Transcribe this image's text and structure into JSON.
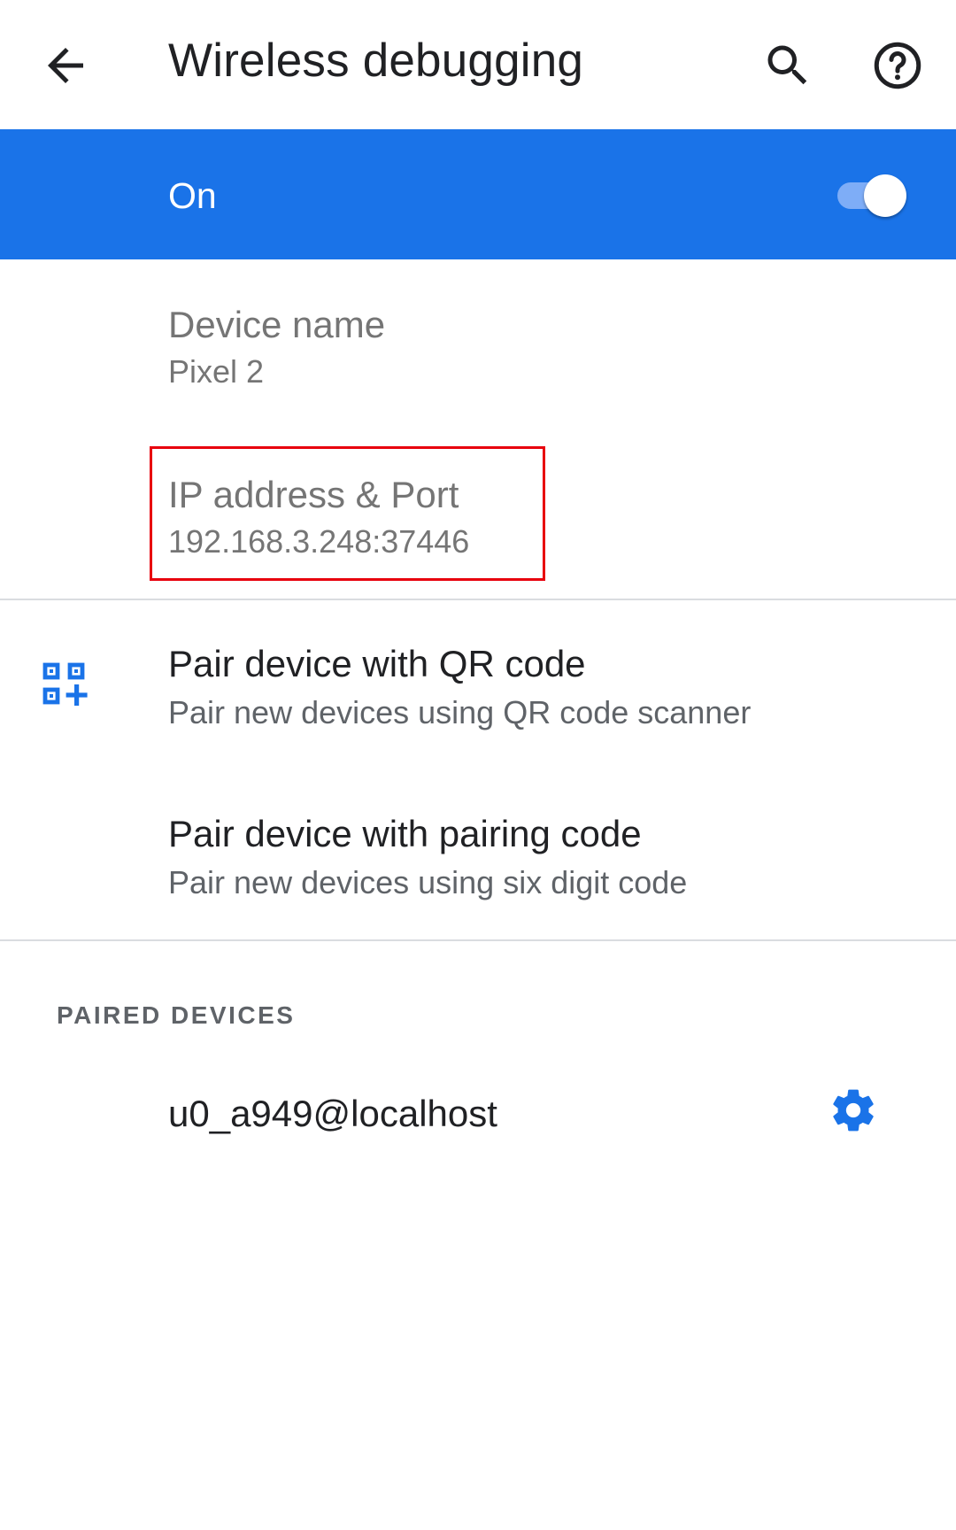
{
  "appbar": {
    "title": "Wireless debugging",
    "back_icon": "arrow-back-icon",
    "search_icon": "search-icon",
    "help_icon": "help-icon"
  },
  "master_switch": {
    "label": "On",
    "checked": true,
    "accent": "#1a73e8"
  },
  "device_name": {
    "title": "Device name",
    "summary": "Pixel 2"
  },
  "ip_port": {
    "title": "IP address & Port",
    "summary": "192.168.3.248:37446",
    "highlight_color": "#e8000d"
  },
  "pair_qr": {
    "title": "Pair device with QR code",
    "summary": "Pair new devices using QR code scanner",
    "icon": "qr-code-add-icon"
  },
  "pair_code": {
    "title": "Pair device with pairing code",
    "summary": "Pair new devices using six digit code"
  },
  "paired_devices": {
    "header": "PAIRED DEVICES",
    "items": [
      {
        "name": "u0_a949@localhost",
        "icon": "settings-gear-icon"
      }
    ]
  }
}
